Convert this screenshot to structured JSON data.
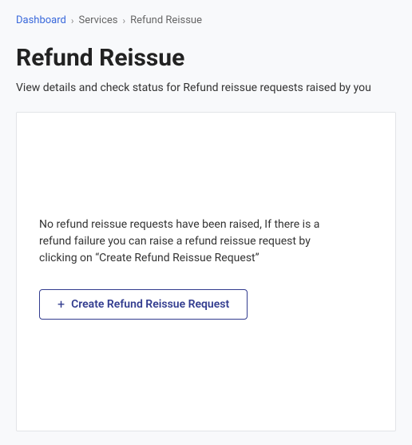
{
  "breadcrumb": {
    "items": [
      {
        "label": "Dashboard",
        "link": true
      },
      {
        "label": "Services",
        "link": false
      },
      {
        "label": "Refund Reissue",
        "link": false
      }
    ],
    "separator": "›"
  },
  "page": {
    "title": "Refund Reissue",
    "subtitle": "View details and check status for Refund reissue requests raised by you"
  },
  "card": {
    "empty_message": "No refund reissue requests have been raised, If there is a refund failure you can raise a refund reissue request by clicking on “Create Refund Reissue Request”",
    "create_button_label": "Create Refund Reissue Request"
  },
  "icons": {
    "plus": "+"
  }
}
